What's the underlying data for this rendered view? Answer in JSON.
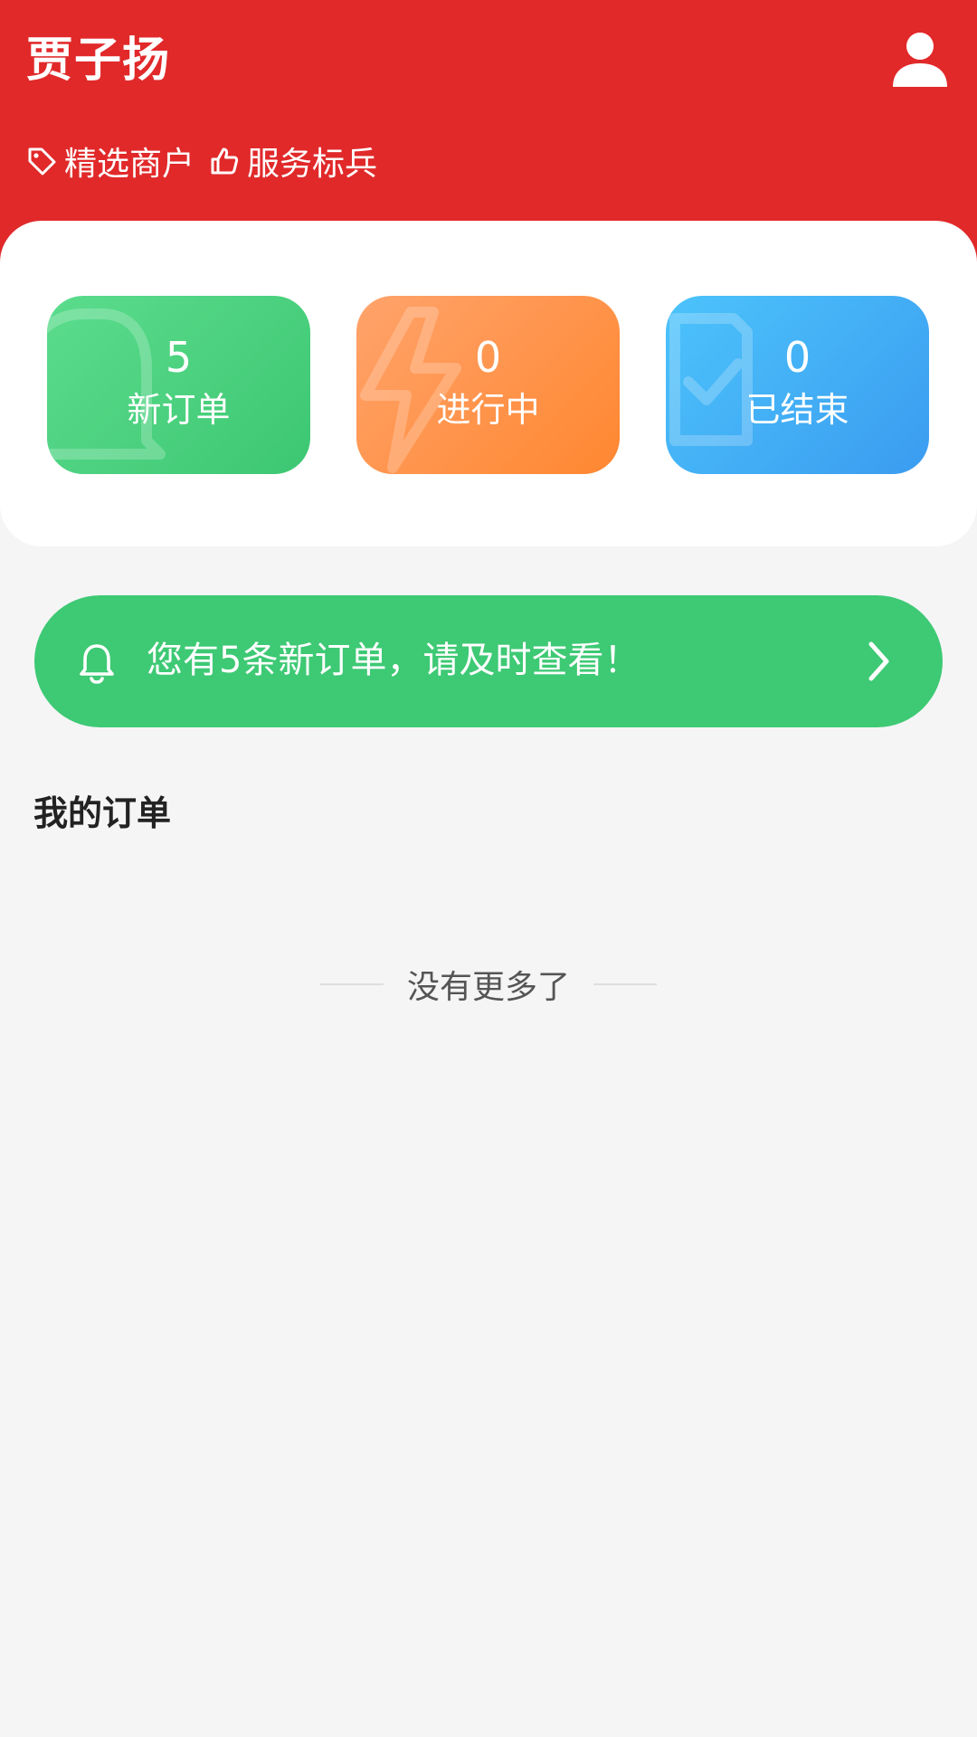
{
  "header": {
    "merchant_name": "贾子扬",
    "profile_icon": "user-icon",
    "tags": [
      {
        "icon": "tag-icon",
        "label": "精选商户"
      },
      {
        "icon": "thumbs-up-icon",
        "label": "服务标兵"
      }
    ],
    "color": "#e1292a"
  },
  "stats": [
    {
      "count": "5",
      "label": "新订单",
      "icon": "bell-icon",
      "color": "#3dc772"
    },
    {
      "count": "0",
      "label": "进行中",
      "icon": "lightning-icon",
      "color": "#ff8730"
    },
    {
      "count": "0",
      "label": "已结束",
      "icon": "checklist-icon",
      "color": "#3b9cf0"
    }
  ],
  "notice": {
    "icon": "bell-icon",
    "text": "您有5条新订单，请及时查看！",
    "action_icon": "chevron-right-icon",
    "color": "#3ec974"
  },
  "orders": {
    "title": "我的订单",
    "empty_text": "没有更多了"
  }
}
